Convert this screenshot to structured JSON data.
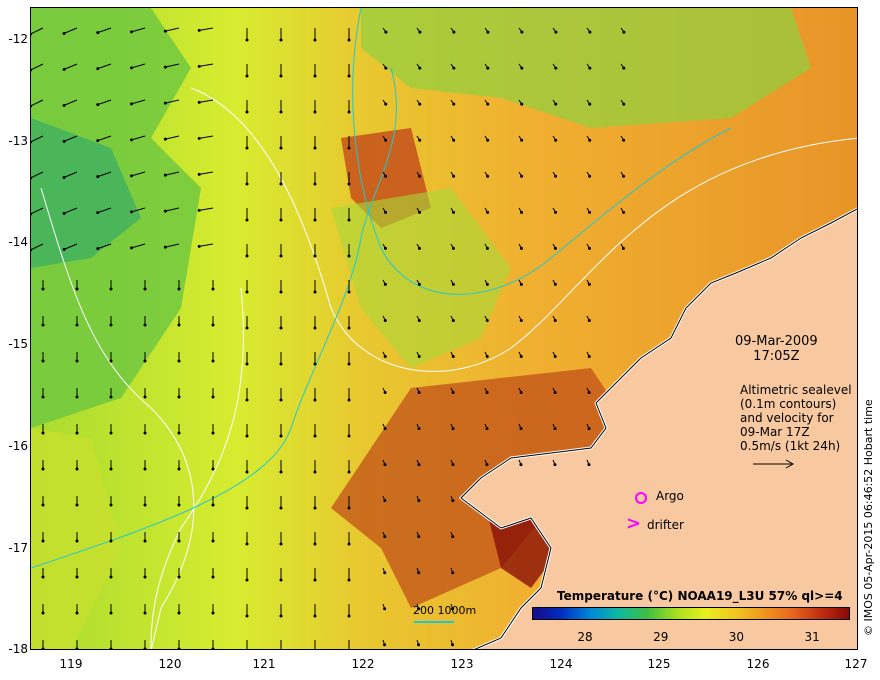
{
  "axes": {
    "lon_ticks": [
      "119",
      "120",
      "121",
      "122",
      "123",
      "124",
      "125",
      "126",
      "127"
    ],
    "lat_ticks": [
      "-12",
      "-13",
      "-14",
      "-15",
      "-16",
      "-17",
      "-18"
    ],
    "lon_range": [
      118.6,
      127.0
    ],
    "lat_range": [
      -18.0,
      -11.85
    ]
  },
  "annotation": {
    "date": "09-Mar-2009",
    "time": "17:05Z",
    "altimetry_lines": [
      "Altimetric sealevel",
      "(0.1m contours)",
      "and velocity for",
      "09-Mar 17Z",
      "0.5m/s (1kt 24h)"
    ]
  },
  "legend": {
    "argo_label": "Argo",
    "drifter_label": "drifter",
    "argo_color": "#ff00ff",
    "drifter_color": "#ff00ff",
    "depth_contours": "200  1000m",
    "depth_contour_color": "#20c8d0"
  },
  "colorbar": {
    "title": "Temperature (°C) NOAA19_L3U 57% ql>=4",
    "range": [
      27.3,
      31.5
    ],
    "ticks": [
      {
        "label": "28",
        "value": 28
      },
      {
        "label": "29",
        "value": 29
      },
      {
        "label": "30",
        "value": 30
      },
      {
        "label": "31",
        "value": 31
      }
    ],
    "colors": [
      "#1a0a8c",
      "#0030c0",
      "#0088d8",
      "#10b8a0",
      "#40c040",
      "#a8e020",
      "#e8f020",
      "#f0c820",
      "#f09820",
      "#e86820",
      "#c03010",
      "#8a0808"
    ]
  },
  "credit": "© IMOS 05-Apr-2015 06:46:52 Hobart time",
  "colors": {
    "land": "#f8c8a0",
    "sea_warm": "#f0a830",
    "sea_mid": "#e8d830",
    "sea_cool": "#60c840",
    "sea_hot": "#c04010"
  }
}
